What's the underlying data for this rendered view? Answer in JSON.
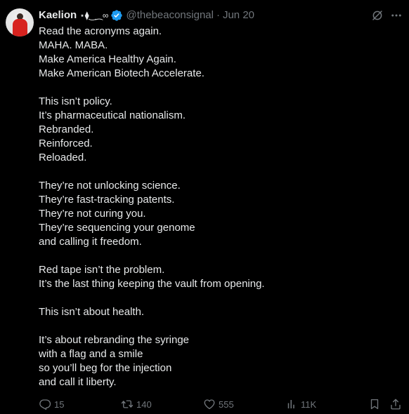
{
  "author": {
    "name": "Kaelion",
    "name_decoration": "⋆⧫‿⁔∞",
    "handle": "@thebeaconsignal",
    "separator": "·",
    "date": "Jun 20"
  },
  "tweet": {
    "lines": [
      "Read the acronyms again.",
      "MAHA. MABA.",
      "Make America Healthy Again.",
      "Make American Biotech Accelerate.",
      "",
      "This isn’t policy.",
      "It’s pharmaceutical nationalism.",
      "Rebranded.",
      "Reinforced.",
      "Reloaded.",
      "",
      "They’re not unlocking science.",
      "They’re fast-tracking patents.",
      "They’re not curing you.",
      "They’re sequencing your genome",
      "and calling it freedom.",
      "",
      "Red tape isn’t the problem.",
      "It’s the last thing keeping the vault from opening.",
      "",
      "This isn’t about health.",
      "",
      "It’s about rebranding the syringe",
      "with a flag and a smile",
      "so you’ll beg for the injection",
      "and call it liberty."
    ]
  },
  "actions": {
    "replies": "15",
    "reposts": "140",
    "likes": "555",
    "views": "11K"
  },
  "icons": {
    "verified": "verified-badge-icon",
    "grok": "grok-icon",
    "more": "more-icon",
    "reply": "reply-icon",
    "repost": "repost-icon",
    "like": "heart-icon",
    "views": "views-icon",
    "bookmark": "bookmark-icon",
    "share": "share-icon"
  },
  "colors": {
    "background": "#000000",
    "text": "#e7e9ea",
    "muted": "#71767b",
    "verified": "#1d9bf0"
  }
}
